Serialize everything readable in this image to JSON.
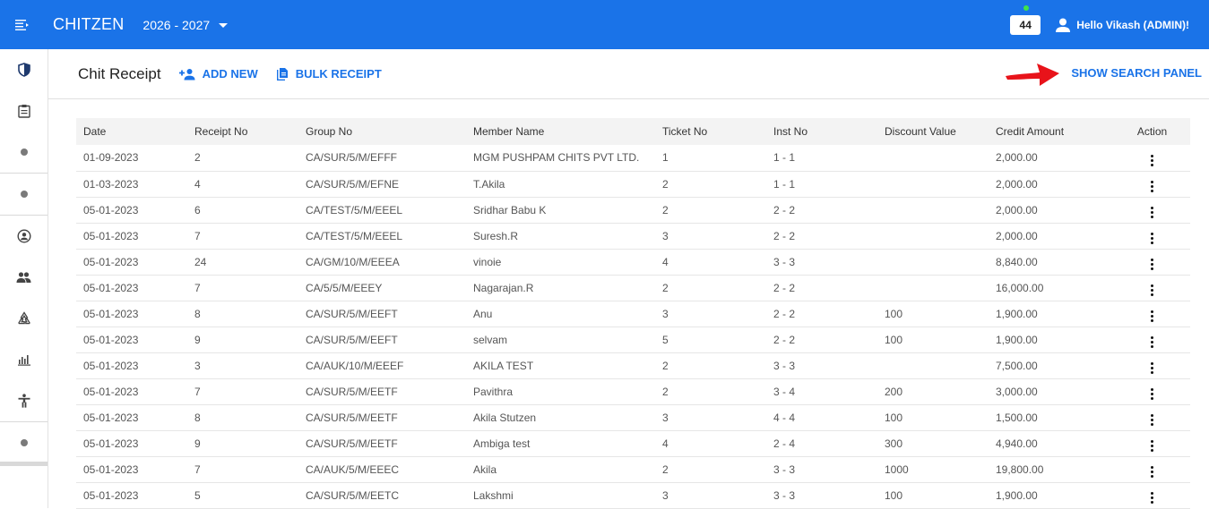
{
  "app": {
    "brand": "CHITZEN",
    "year": "2026 - 2027"
  },
  "topbar": {
    "notification_count": "44",
    "user_greeting": "Hello Vikash (ADMIN)!"
  },
  "colors": {
    "primary": "#1a73e8",
    "online": "#3fe34a",
    "arrow": "#e8131a"
  },
  "sidebar": {
    "items": [
      {
        "icon": "shield-icon"
      },
      {
        "icon": "clipboard-icon"
      },
      {
        "icon": "dot-icon"
      },
      {
        "icon": "dot-icon"
      },
      {
        "icon": "account-circle-icon"
      },
      {
        "icon": "people-icon"
      },
      {
        "icon": "recycle-icon"
      },
      {
        "icon": "bar-chart-icon"
      },
      {
        "icon": "accessibility-icon"
      },
      {
        "icon": "dot-icon"
      }
    ]
  },
  "header": {
    "title": "Chit Receipt",
    "add_new": "ADD NEW",
    "bulk_receipt": "BULK RECEIPT",
    "show_search_panel": "SHOW SEARCH PANEL"
  },
  "table": {
    "columns": [
      "Date",
      "Receipt No",
      "Group No",
      "Member Name",
      "Ticket No",
      "Inst No",
      "Discount Value",
      "Credit Amount",
      "Action"
    ],
    "rows": [
      [
        "01-09-2023",
        "2",
        "CA/SUR/5/M/EFFF",
        "MGM PUSHPAM CHITS PVT LTD.",
        "1",
        "1 - 1",
        "",
        "2,000.00"
      ],
      [
        "01-03-2023",
        "4",
        "CA/SUR/5/M/EFNE",
        "T.Akila",
        "2",
        "1 - 1",
        "",
        "2,000.00"
      ],
      [
        "05-01-2023",
        "6",
        "CA/TEST/5/M/EEEL",
        "Sridhar Babu K",
        "2",
        "2 - 2",
        "",
        "2,000.00"
      ],
      [
        "05-01-2023",
        "7",
        "CA/TEST/5/M/EEEL",
        "Suresh.R",
        "3",
        "2 - 2",
        "",
        "2,000.00"
      ],
      [
        "05-01-2023",
        "24",
        "CA/GM/10/M/EEEA",
        "vinoie",
        "4",
        "3 - 3",
        "",
        "8,840.00"
      ],
      [
        "05-01-2023",
        "7",
        "CA/5/5/M/EEEY",
        "Nagarajan.R",
        "2",
        "2 - 2",
        "",
        "16,000.00"
      ],
      [
        "05-01-2023",
        "8",
        "CA/SUR/5/M/EEFT",
        "Anu",
        "3",
        "2 - 2",
        "100",
        "1,900.00"
      ],
      [
        "05-01-2023",
        "9",
        "CA/SUR/5/M/EEFT",
        "selvam",
        "5",
        "2 - 2",
        "100",
        "1,900.00"
      ],
      [
        "05-01-2023",
        "3",
        "CA/AUK/10/M/EEEF",
        "AKILA TEST",
        "2",
        "3 - 3",
        "",
        "7,500.00"
      ],
      [
        "05-01-2023",
        "7",
        "CA/SUR/5/M/EETF",
        "Pavithra",
        "2",
        "3 - 4",
        "200",
        "3,000.00"
      ],
      [
        "05-01-2023",
        "8",
        "CA/SUR/5/M/EETF",
        "Akila Stutzen",
        "3",
        "4 - 4",
        "100",
        "1,500.00"
      ],
      [
        "05-01-2023",
        "9",
        "CA/SUR/5/M/EETF",
        "Ambiga test",
        "4",
        "2 - 4",
        "300",
        "4,940.00"
      ],
      [
        "05-01-2023",
        "7",
        "CA/AUK/5/M/EEEC",
        "Akila",
        "2",
        "3 - 3",
        "1000",
        "19,800.00"
      ],
      [
        "05-01-2023",
        "5",
        "CA/SUR/5/M/EETC",
        "Lakshmi",
        "3",
        "3 - 3",
        "100",
        "1,900.00"
      ]
    ]
  }
}
